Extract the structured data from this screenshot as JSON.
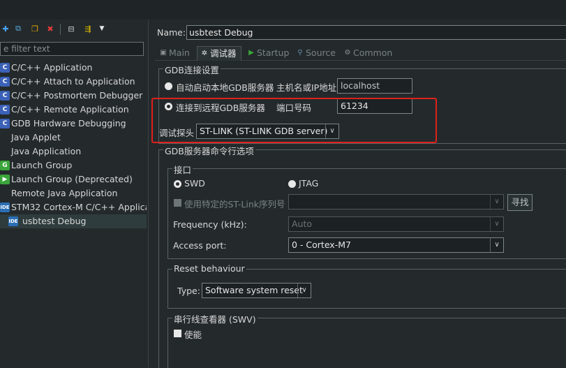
{
  "toolbar": {
    "icons": [
      "new-config-icon",
      "duplicate-icon",
      "copy-icon",
      "delete-icon",
      "collapse-all-icon",
      "filter-icon",
      "dropdown-icon"
    ]
  },
  "filter": {
    "placeholder": "e filter text"
  },
  "tree": {
    "items": [
      {
        "label": "C/C++ Application",
        "icon": "C",
        "color": "#3b62b8"
      },
      {
        "label": "C/C++ Attach to Application",
        "icon": "C",
        "color": "#3b62b8"
      },
      {
        "label": "C/C++ Postmortem Debugger",
        "icon": "C",
        "color": "#3b62b8"
      },
      {
        "label": "C/C++ Remote Application",
        "icon": "C",
        "color": "#3b62b8"
      },
      {
        "label": "GDB Hardware Debugging",
        "icon": "C",
        "color": "#3b62b8"
      },
      {
        "label": "Java Applet",
        "icon": "",
        "color": ""
      },
      {
        "label": "Java Application",
        "icon": "",
        "color": ""
      },
      {
        "label": "Launch Group",
        "icon": "G",
        "color": "#3aa63a"
      },
      {
        "label": "Launch Group (Deprecated)",
        "icon": "▶",
        "color": "#3aa63a"
      },
      {
        "label": "Remote Java Application",
        "icon": "",
        "color": ""
      },
      {
        "label": "STM32 Cortex-M C/C++ Applicat",
        "icon": "IDE",
        "color": "#2a6fb5"
      },
      {
        "label": "usbtest Debug",
        "icon": "IDE",
        "color": "#2a6fb5"
      }
    ]
  },
  "name": {
    "label": "Name:",
    "value": "usbtest Debug"
  },
  "tabs": [
    {
      "label": "Main",
      "icon": "main-tab-icon"
    },
    {
      "label": "调试器",
      "icon": "debugger-tab-icon"
    },
    {
      "label": "Startup",
      "icon": "startup-tab-icon"
    },
    {
      "label": "Source",
      "icon": "source-tab-icon"
    },
    {
      "label": "Common",
      "icon": "common-tab-icon"
    }
  ],
  "gdb_conn": {
    "title": "GDB连接设置",
    "auto_label": "自动启动本地GDB服务器",
    "host_label": "主机名或IP地址",
    "host_value": "localhost",
    "remote_label": "连接到远程GDB服务器",
    "port_label": "端口号码",
    "port_value": "61234",
    "probe_label": "调试探头",
    "probe_value": "ST-LINK (ST-LINK GDB server)"
  },
  "gdb_opts": {
    "title": "GDB服务器命令行选项",
    "interface": {
      "title": "接口",
      "swd": "SWD",
      "jtag": "JTAG",
      "serial_label": "使用特定的ST-Link序列号",
      "find_button": "寻找",
      "freq_label": "Frequency (kHz):",
      "freq_value": "Auto",
      "port_label": "Access port:",
      "port_value": "0 - Cortex-M7"
    },
    "reset": {
      "title": "Reset behaviour",
      "type_label": "Type:",
      "type_value": "Software system reset"
    },
    "swv": {
      "title": "串行线查看器 (SWV)",
      "enable_label": "使能"
    }
  },
  "colors": {
    "highlight": "#e0201c",
    "background": "#242a2c"
  }
}
